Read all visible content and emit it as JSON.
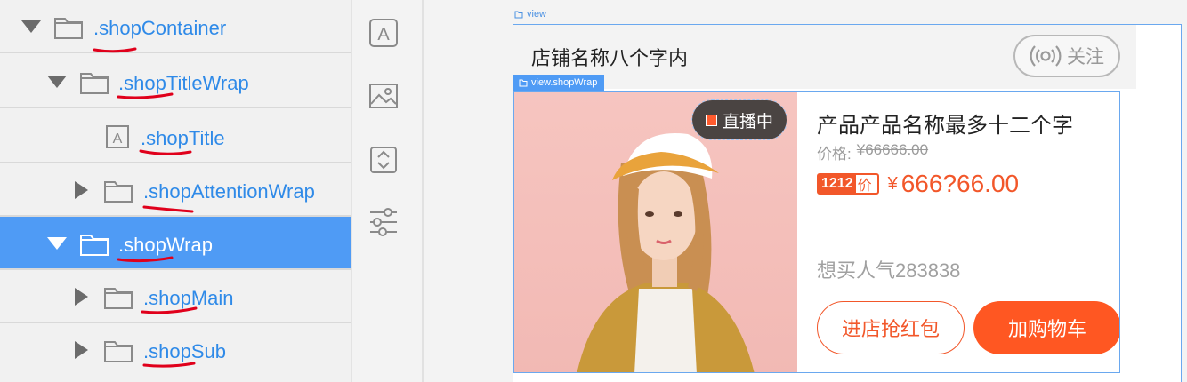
{
  "tree": {
    "items": [
      {
        "label": ".shopContainer",
        "expanded": true,
        "icon": "folder-icon",
        "selected": false
      },
      {
        "label": ".shopTitleWrap",
        "expanded": true,
        "icon": "folder-icon",
        "selected": false
      },
      {
        "label": ".shopTitle",
        "icon": "text-element-icon",
        "selected": false
      },
      {
        "label": ".shopAttentionWrap",
        "expanded": false,
        "icon": "folder-icon",
        "selected": false
      },
      {
        "label": ".shopWrap",
        "expanded": true,
        "icon": "folder-icon",
        "selected": true
      },
      {
        "label": ".shopMain",
        "expanded": false,
        "icon": "folder-icon",
        "selected": false
      },
      {
        "label": ".shopSub",
        "expanded": false,
        "icon": "folder-icon",
        "selected": false
      }
    ]
  },
  "toolbar": {
    "tools": [
      "text-tool-icon",
      "image-tool-icon",
      "scroll-tool-icon",
      "settings-sliders-icon"
    ]
  },
  "canvas": {
    "view_label": "view",
    "shopwrap_label": "view.shopWrap",
    "shop_title": "店铺名称八个字内",
    "follow_label": "关注",
    "live_badge": "直播中",
    "product_name": "产品产品名称最多十二个字",
    "price_label": "价格:",
    "original_price": "¥66666.00",
    "promo_number": "1212",
    "promo_suffix": "价",
    "currency": "¥",
    "sale_price": "666?66.00",
    "popularity": "想买人气283838",
    "enter_shop_label": "进店抢红包",
    "add_cart_label": "加购物车"
  },
  "colors": {
    "accent": "#2f8ae8",
    "selected_row": "#4f9bf5",
    "price": "#f2572a",
    "underline": "#e0001b"
  }
}
